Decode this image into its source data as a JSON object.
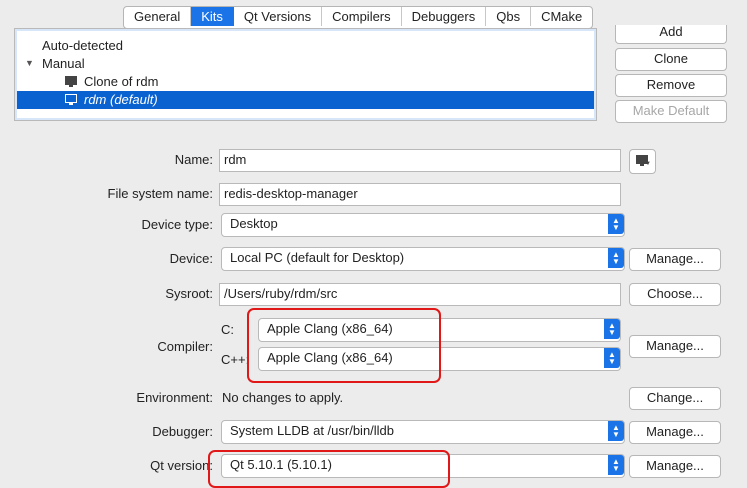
{
  "tabs": [
    "General",
    "Kits",
    "Qt Versions",
    "Compilers",
    "Debuggers",
    "Qbs",
    "CMake"
  ],
  "kit_list": {
    "auto_detected": "Auto-detected",
    "manual": "Manual",
    "clone_item": "Clone of rdm",
    "selected_item": "rdm (default)"
  },
  "list_buttons": {
    "add": "Add",
    "clone": "Clone",
    "remove": "Remove",
    "make_default": "Make Default"
  },
  "form": {
    "name_label": "Name:",
    "name_value": "rdm",
    "fs_label": "File system name:",
    "fs_value": "redis-desktop-manager",
    "device_type_label": "Device type:",
    "device_type_value": "Desktop",
    "device_label": "Device:",
    "device_value": "Local PC (default for Desktop)",
    "sysroot_label": "Sysroot:",
    "sysroot_value": "/Users/ruby/rdm/src",
    "compiler_label": "Compiler:",
    "c_label": "C:",
    "c_value": "Apple Clang (x86_64)",
    "cpp_label": "C++:",
    "cpp_value": "Apple Clang (x86_64)",
    "environment_label": "Environment:",
    "environment_value": "No changes to apply.",
    "debugger_label": "Debugger:",
    "debugger_value": "System LLDB at /usr/bin/lldb",
    "qt_version_label": "Qt version:",
    "qt_version_value": "Qt 5.10.1 (5.10.1)"
  },
  "side_buttons": {
    "manage": "Manage...",
    "choose": "Choose...",
    "change": "Change..."
  },
  "colors": {
    "accent": "#1b73e8",
    "highlight": "#e01818"
  }
}
